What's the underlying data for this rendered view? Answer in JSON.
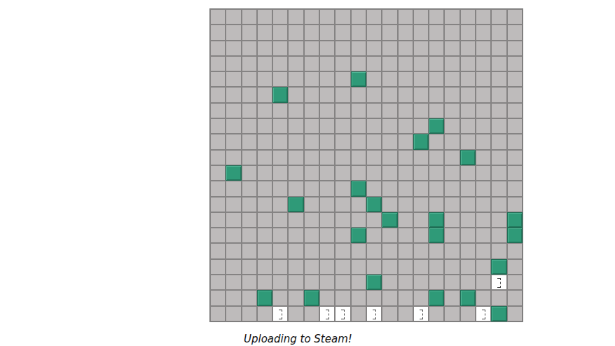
{
  "board": {
    "cells": [
      [
        "empty",
        "empty",
        "empty",
        "empty",
        "empty",
        "empty",
        "empty",
        "empty",
        "empty",
        "empty",
        "empty",
        "empty",
        "empty",
        "empty",
        "empty",
        "empty",
        "empty",
        "empty",
        "empty",
        "empty"
      ],
      [
        "empty",
        "empty",
        "empty",
        "empty",
        "empty",
        "empty",
        "empty",
        "empty",
        "empty",
        "empty",
        "empty",
        "empty",
        "empty",
        "empty",
        "empty",
        "empty",
        "empty",
        "empty",
        "empty",
        "empty"
      ],
      [
        "empty",
        "empty",
        "empty",
        "empty",
        "empty",
        "empty",
        "empty",
        "empty",
        "empty",
        "empty",
        "empty",
        "empty",
        "empty",
        "empty",
        "empty",
        "empty",
        "empty",
        "empty",
        "empty",
        "empty"
      ],
      [
        "empty",
        "empty",
        "empty",
        "empty",
        "empty",
        "empty",
        "empty",
        "empty",
        "empty",
        "empty",
        "empty",
        "empty",
        "empty",
        "empty",
        "empty",
        "empty",
        "empty",
        "empty",
        "empty",
        "empty"
      ],
      [
        "empty",
        "empty",
        "empty",
        "empty",
        "empty",
        "empty",
        "empty",
        "empty",
        "empty",
        "block",
        "empty",
        "empty",
        "empty",
        "empty",
        "empty",
        "empty",
        "empty",
        "empty",
        "empty",
        "empty"
      ],
      [
        "empty",
        "empty",
        "empty",
        "empty",
        "block",
        "empty",
        "empty",
        "empty",
        "empty",
        "empty",
        "empty",
        "empty",
        "empty",
        "empty",
        "empty",
        "empty",
        "empty",
        "empty",
        "empty",
        "empty"
      ],
      [
        "empty",
        "empty",
        "empty",
        "empty",
        "empty",
        "empty",
        "empty",
        "empty",
        "empty",
        "empty",
        "empty",
        "empty",
        "empty",
        "empty",
        "empty",
        "empty",
        "empty",
        "empty",
        "empty",
        "empty"
      ],
      [
        "empty",
        "empty",
        "empty",
        "empty",
        "empty",
        "empty",
        "empty",
        "empty",
        "empty",
        "empty",
        "empty",
        "empty",
        "empty",
        "empty",
        "block",
        "empty",
        "empty",
        "empty",
        "empty",
        "empty"
      ],
      [
        "empty",
        "empty",
        "empty",
        "empty",
        "empty",
        "empty",
        "empty",
        "empty",
        "empty",
        "empty",
        "empty",
        "empty",
        "empty",
        "block",
        "empty",
        "empty",
        "empty",
        "empty",
        "empty",
        "empty"
      ],
      [
        "empty",
        "empty",
        "empty",
        "empty",
        "empty",
        "empty",
        "empty",
        "empty",
        "empty",
        "empty",
        "empty",
        "empty",
        "empty",
        "empty",
        "empty",
        "empty",
        "block",
        "empty",
        "empty",
        "empty"
      ],
      [
        "empty",
        "block",
        "empty",
        "empty",
        "empty",
        "empty",
        "empty",
        "empty",
        "empty",
        "empty",
        "empty",
        "empty",
        "empty",
        "empty",
        "empty",
        "empty",
        "empty",
        "empty",
        "empty",
        "empty"
      ],
      [
        "empty",
        "empty",
        "empty",
        "empty",
        "empty",
        "empty",
        "empty",
        "empty",
        "empty",
        "block",
        "empty",
        "empty",
        "empty",
        "empty",
        "empty",
        "empty",
        "empty",
        "empty",
        "empty",
        "empty"
      ],
      [
        "empty",
        "empty",
        "empty",
        "empty",
        "empty",
        "block",
        "empty",
        "empty",
        "empty",
        "empty",
        "block",
        "empty",
        "empty",
        "empty",
        "empty",
        "empty",
        "empty",
        "empty",
        "empty",
        "empty"
      ],
      [
        "empty",
        "empty",
        "empty",
        "empty",
        "empty",
        "empty",
        "empty",
        "empty",
        "empty",
        "empty",
        "empty",
        "block",
        "empty",
        "empty",
        "block",
        "empty",
        "empty",
        "empty",
        "empty",
        "block"
      ],
      [
        "empty",
        "empty",
        "empty",
        "empty",
        "empty",
        "empty",
        "empty",
        "empty",
        "empty",
        "block",
        "empty",
        "empty",
        "empty",
        "empty",
        "block",
        "empty",
        "empty",
        "empty",
        "empty",
        "block"
      ],
      [
        "empty",
        "empty",
        "empty",
        "empty",
        "empty",
        "empty",
        "empty",
        "empty",
        "empty",
        "empty",
        "empty",
        "empty",
        "empty",
        "empty",
        "empty",
        "empty",
        "empty",
        "empty",
        "empty",
        "empty"
      ],
      [
        "empty",
        "empty",
        "empty",
        "empty",
        "empty",
        "empty",
        "empty",
        "empty",
        "empty",
        "empty",
        "empty",
        "empty",
        "empty",
        "empty",
        "empty",
        "empty",
        "empty",
        "empty",
        "block",
        "empty"
      ],
      [
        "empty",
        "empty",
        "empty",
        "empty",
        "empty",
        "empty",
        "empty",
        "empty",
        "empty",
        "empty",
        "block",
        "empty",
        "empty",
        "empty",
        "empty",
        "empty",
        "empty",
        "empty",
        "open",
        "empty"
      ],
      [
        "empty",
        "empty",
        "empty",
        "block",
        "empty",
        "empty",
        "block",
        "empty",
        "empty",
        "empty",
        "empty",
        "empty",
        "empty",
        "empty",
        "block",
        "empty",
        "block",
        "empty",
        "empty",
        "empty"
      ],
      [
        "empty",
        "empty",
        "empty",
        "empty",
        "open",
        "empty",
        "empty",
        "open",
        "open",
        "empty",
        "open",
        "empty",
        "empty",
        "open",
        "empty",
        "empty",
        "empty",
        "open",
        "block",
        "empty"
      ]
    ]
  },
  "status": "Uploading to Steam!"
}
